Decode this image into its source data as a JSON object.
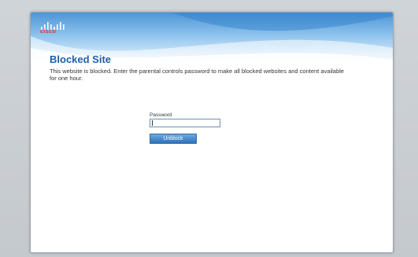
{
  "brand": {
    "logo_icon": "cisco-logo-icon",
    "logo_text": "cisco",
    "logo_color": "#d23a2f",
    "bars_color": "#4a8fd0"
  },
  "page": {
    "title": "Blocked Site",
    "message": "This website is blocked. Enter the parental controls password to make all blocked websites and content available for one hour.",
    "title_color": "#1f5fa8"
  },
  "form": {
    "password_label": "Password",
    "password_value": "",
    "unblock_label": "Unblock",
    "button_color": "#2f73bb"
  }
}
